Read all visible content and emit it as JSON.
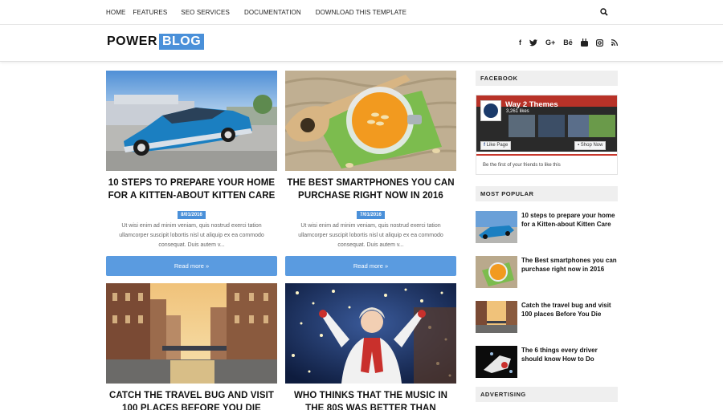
{
  "nav": {
    "items": [
      "HOME",
      "FEATURES",
      "SEO SERVICES",
      "DOCUMENTATION",
      "DOWNLOAD THIS TEMPLATE"
    ]
  },
  "logo": {
    "part1": "POWER",
    "part2": "BLOG"
  },
  "social": [
    "f",
    "t",
    "G+",
    "Bē",
    "yt",
    "ig",
    "rss"
  ],
  "posts": [
    {
      "title": "10 STEPS TO PREPARE YOUR HOME FOR A KITTEN-ABOUT KITTEN CARE",
      "date": "8/01/2016",
      "excerpt": "Ut wisi enim ad minim veniam, quis nostrud exerci tation ullamcorper suscipit lobortis nisl ut aliquip ex ea commodo consequat. Duis autem v...",
      "button": "Read more »"
    },
    {
      "title": "THE BEST SMARTPHONES YOU CAN PURCHASE RIGHT NOW IN 2016",
      "date": "7/01/2016",
      "excerpt": "Ut wisi enim ad minim veniam, quis nostrud exerci tation ullamcorper suscipit lobortis nisl ut aliquip ex ea commodo consequat. Duis autem v...",
      "button": "Read more »"
    },
    {
      "title": "CATCH THE TRAVEL BUG AND VISIT 100 PLACES BEFORE YOU DIE"
    },
    {
      "title": "WHO THINKS THAT THE MUSIC IN THE 80S WAS BETTER THAN"
    }
  ],
  "sidebar": {
    "facebook": {
      "heading": "FACEBOOK",
      "page_name": "Way 2 Themes",
      "likes": "3,261 likes",
      "like_button": "Like Page",
      "shop_button": "Shop Now",
      "friends_text": "Be the first of your friends to like this"
    },
    "popular": {
      "heading": "MOST POPULAR",
      "items": [
        "10 steps to prepare your home for a Kitten-about Kitten Care",
        "The Best smartphones you can purchase right now in 2016",
        "Catch the travel bug and visit 100 places Before You Die",
        "The 6 things every driver should know How to Do"
      ]
    },
    "advertising": {
      "heading": "ADVERTISING"
    }
  }
}
